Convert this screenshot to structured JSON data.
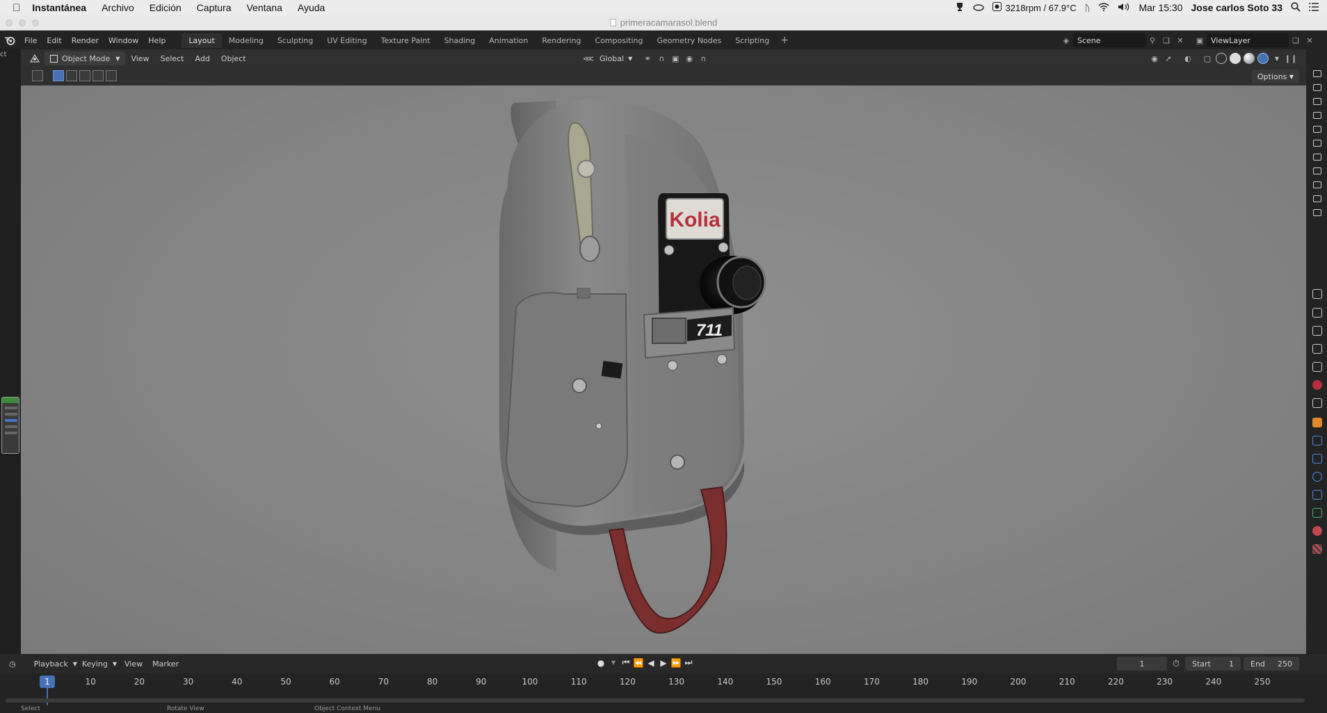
{
  "macbar": {
    "app": "Instantánea",
    "menus": [
      "Archivo",
      "Edición",
      "Captura",
      "Ventana",
      "Ayuda"
    ],
    "fan": "3218rpm / 67.9°C",
    "datetime": "Mar 15:30",
    "user": "Jose carlos Soto 33"
  },
  "window": {
    "title": "primeracamarasol.blend"
  },
  "topbar": {
    "menus": [
      "File",
      "Edit",
      "Render",
      "Window",
      "Help"
    ],
    "tabs": [
      "Layout",
      "Modeling",
      "Sculpting",
      "UV Editing",
      "Texture Paint",
      "Shading",
      "Animation",
      "Rendering",
      "Compositing",
      "Geometry Nodes",
      "Scripting"
    ],
    "active_tab": "Layout",
    "add_tab": "+",
    "scene": "Scene",
    "view_layer": "ViewLayer"
  },
  "viewport_header": {
    "mode": "Object Mode",
    "menus": [
      "View",
      "Select",
      "Add",
      "Object"
    ],
    "orientation": "Global"
  },
  "toolrow": {
    "options": "Options"
  },
  "model": {
    "brand": "Kolia",
    "model_number": "711"
  },
  "timeline": {
    "menus": [
      "Playback",
      "Keying",
      "View",
      "Marker"
    ],
    "current_frame": "1",
    "start_label": "Start",
    "start": "1",
    "end_label": "End",
    "end": "250",
    "ticks": [
      "10",
      "20",
      "30",
      "40",
      "50",
      "60",
      "70",
      "80",
      "90",
      "100",
      "110",
      "120",
      "130",
      "140",
      "150",
      "160",
      "170",
      "180",
      "190",
      "200",
      "210",
      "220",
      "230",
      "240",
      "250"
    ]
  },
  "statusbar": [
    "Select",
    "Rotate View",
    "Object Context Menu"
  ],
  "colors": {
    "accent": "#4772b3",
    "viewport_bg": "#878787",
    "camera_body": "#7e7e7e",
    "strap": "#7a2e2e",
    "logo_red": "#b5303a"
  }
}
